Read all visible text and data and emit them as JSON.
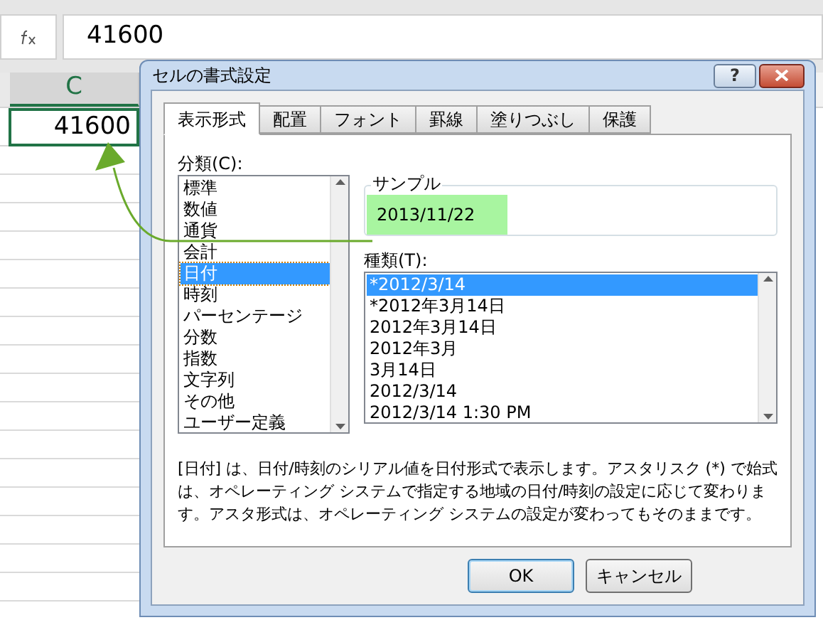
{
  "formula_bar": {
    "value": "41600"
  },
  "sheet": {
    "column_header": {
      "label": "C",
      "selected": true
    },
    "active_cell": {
      "value": "41600"
    }
  },
  "dialog": {
    "title": "セルの書式設定",
    "help_button": "?",
    "tabs": [
      {
        "label": "表示形式",
        "selected": true
      },
      {
        "label": "配置",
        "selected": false
      },
      {
        "label": "フォント",
        "selected": false
      },
      {
        "label": "罫線",
        "selected": false
      },
      {
        "label": "塗りつぶし",
        "selected": false
      },
      {
        "label": "保護",
        "selected": false
      }
    ],
    "category_label": "分類(C):",
    "categories": [
      {
        "label": "標準",
        "selected": false
      },
      {
        "label": "数値",
        "selected": false
      },
      {
        "label": "通貨",
        "selected": false
      },
      {
        "label": "会計",
        "selected": false
      },
      {
        "label": "日付",
        "selected": true
      },
      {
        "label": "時刻",
        "selected": false
      },
      {
        "label": "パーセンテージ",
        "selected": false
      },
      {
        "label": "分数",
        "selected": false
      },
      {
        "label": "指数",
        "selected": false
      },
      {
        "label": "文字列",
        "selected": false
      },
      {
        "label": "その他",
        "selected": false
      },
      {
        "label": "ユーザー定義",
        "selected": false
      }
    ],
    "sample": {
      "label": "サンプル",
      "value": "2013/11/22"
    },
    "type_label": "種類(T):",
    "types": [
      {
        "label": "*2012/3/14",
        "selected": true
      },
      {
        "label": "*2012年3月14日",
        "selected": false
      },
      {
        "label": "2012年3月14日",
        "selected": false
      },
      {
        "label": "2012年3月",
        "selected": false
      },
      {
        "label": "3月14日",
        "selected": false
      },
      {
        "label": "2012/3/14",
        "selected": false
      },
      {
        "label": "2012/3/14 1:30 PM",
        "selected": false
      }
    ],
    "description": "[日付] は、日付/時刻のシリアル値を日付形式で表示します。アスタリスク (*) で始式は、オペレーティング システムで指定する地域の日付/時刻の設定に応じて変わります。アスタ形式は、オペレーティング システムの設定が変わってもそのままです。",
    "buttons": [
      {
        "label": "OK",
        "default": true
      },
      {
        "label": "キャンセル",
        "default": false
      }
    ]
  }
}
